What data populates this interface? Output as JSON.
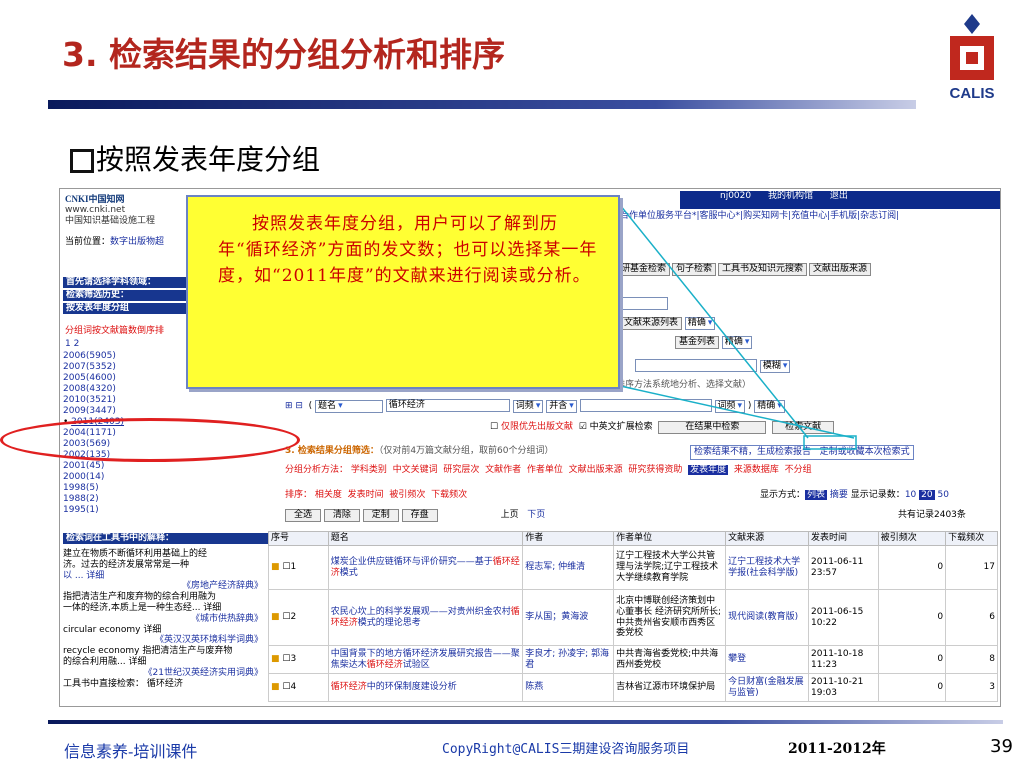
{
  "slide": {
    "title": "3. 检索结果的分组分析和排序",
    "subtitle": "按照发表年度分组",
    "logo_text": "CALIS"
  },
  "tooltip": {
    "text": "按照发表年度分组，用户可以了解到历年“循环经济”方面的发文数；也可以选择某一年度，如“2011年度”的文献来进行阅读或分析。"
  },
  "screenshot": {
    "logo": {
      "name": "CNKI中国知网",
      "url": "www.cnki.net",
      "tagline": "中国知识基础设施工程"
    },
    "user_bar": [
      "nj0020",
      "我的机构馆",
      "退出"
    ],
    "top_links": "合作单位服务平台*|客服中心*|购买知网卡|充值中心|手机版|杂志订阅|",
    "current_position": {
      "label": "当前位置：",
      "value": "数字出版物超"
    },
    "left_panel": {
      "head1": "首先请选择学科领域：",
      "head2": "检索筛选历史：",
      "head3": "按发表年度分组",
      "sort_hint": "分组词按文献篇数倒序排",
      "pages": "1 2",
      "years": [
        "2006(5905)",
        "2007(5352)",
        "2005(4600)",
        "2008(4320)",
        "2010(3521)",
        "2009(3447)",
        "2011(2403)",
        "2004(1171)",
        "2003(569)",
        "2002(135)",
        "2001(45)",
        "2000(14)",
        "1998(5)",
        "1988(2)",
        "1995(1)"
      ],
      "head4": "检索词在工具书中的解释：",
      "notes": [
        "建立在物质不断循环利用基础上的经",
        "济。过去的经济发展常常是一种",
        "以 ... 详细",
        "《房地产经济辞典》",
        "指把清洁生产和废弃物的综合利用融为",
        "一体的经济,本质上是一种生态经... 详细",
        "《城市供热辞典》",
        "circular economy 详细",
        "《英汉汉英环境科学词典》",
        "recycle economy 指把清洁生产与废弃物",
        "的综合利用融... 详细",
        "《21世纪汉英经济实用词典》",
        "工具书中直接检索：   循环经济"
      ]
    },
    "tabs": [
      "科研基金检索",
      "句子检索",
      "工具书及知识元搜索",
      "文献出版来源"
    ],
    "search_form": {
      "source_list": "文献来源列表",
      "match": "精确",
      "fund_list": "基金列表",
      "exact": "模糊",
      "row_hint": "2. 输入目标文献内容特征：（由此得到的初次检索结果后，再用第三步的各种分类与排序方法系统地分析、选择文献）",
      "field": "题名",
      "keyword": "循环经济",
      "freq": "词频",
      "logic": "并含",
      "freq2": "词频",
      "match2": "精确",
      "only_first": "仅限优先出版文献",
      "cn_en": "中英文扩展检索",
      "btn_in_result": "在结果中检索",
      "btn_search": "检索文献"
    },
    "filter_bar": {
      "title": "3. 检索结果分组筛选：",
      "hint": "（仅对前4万篇文献分组，取前60个分组词）",
      "links": [
        "检索结果不精，生成检索报告",
        "定制或收藏本次检索式"
      ]
    },
    "group_bar": {
      "label": "分组分析方法：",
      "items": [
        "学科类别",
        "中文关键词",
        "研究层次",
        "文献作者",
        "作者单位",
        "文献出版来源",
        "研究获得资助",
        "发表年度",
        "来源数据库",
        "不分组"
      ]
    },
    "sort_bar": {
      "label": "排序：",
      "items": [
        "相关度",
        "发表时间",
        "被引频次",
        "下载频次"
      ],
      "display": "显示方式：",
      "display_modes": [
        "列表",
        "摘要"
      ],
      "per_page_label": "显示记录数：",
      "per_page": [
        "10",
        "20",
        "50"
      ]
    },
    "action_bar": {
      "buttons": [
        "全选",
        "清除",
        "定制",
        "存盘"
      ],
      "prev": "上页",
      "next": "下页",
      "total": "共有记录2403条"
    },
    "table": {
      "headers": [
        "序号",
        "题名",
        "作者",
        "作者单位",
        "文献来源",
        "发表时间",
        "被引频次",
        "下载频次"
      ],
      "rows": [
        {
          "no": "1",
          "title_a": "煤炭企业供应链循环与评价研究——基于",
          "title_b": "循环经济",
          "title_c": "模式",
          "author": "程志军; 仲维清",
          "org": "辽宁工程技术大学公共管理与法学院;辽宁工程技术大学继续教育学院",
          "source": "辽宁工程技术大学学报(社会科学版)",
          "date": "2011-06-11 23:57",
          "cited": "0",
          "dl": "17"
        },
        {
          "no": "2",
          "title_a": "农民心坎上的科学发展观——对贵州织金农村",
          "title_b": "循环经济",
          "title_c": "模式的理论思考",
          "author": "李从国；黄海波",
          "org": "北京中博联创经济策划中心董事长 经济研究所所长;中共贵州省安顺市西秀区委党校",
          "source": "现代阅读(教育版)",
          "date": "2011-06-15 10:22",
          "cited": "0",
          "dl": "6"
        },
        {
          "no": "3",
          "title_a": "中国背景下的地方循环经济发展研究报告——聚焦柴达木",
          "title_b": "循环经济",
          "title_c": "试验区",
          "author": "李良才; 孙凌宇; 郭海君",
          "org": "中共青海省委党校;中共海西州委党校",
          "source": "攀登",
          "date": "2011-10-18 11:23",
          "cited": "0",
          "dl": "8"
        },
        {
          "no": "4",
          "title_a": "",
          "title_b": "循环经济",
          "title_c": "中的环保制度建设分析",
          "author": "陈燕",
          "org": "吉林省辽源市环境保护局",
          "source": "今日财富(金融发展与监管)",
          "date": "2011-10-21 19:03",
          "cited": "0",
          "dl": "3"
        }
      ]
    }
  },
  "footer": {
    "left": "信息素养-培训课件",
    "middle": "CopyRight@CALIS三期建设咨询服务项目",
    "year": "2011-2012年",
    "page": "39"
  }
}
